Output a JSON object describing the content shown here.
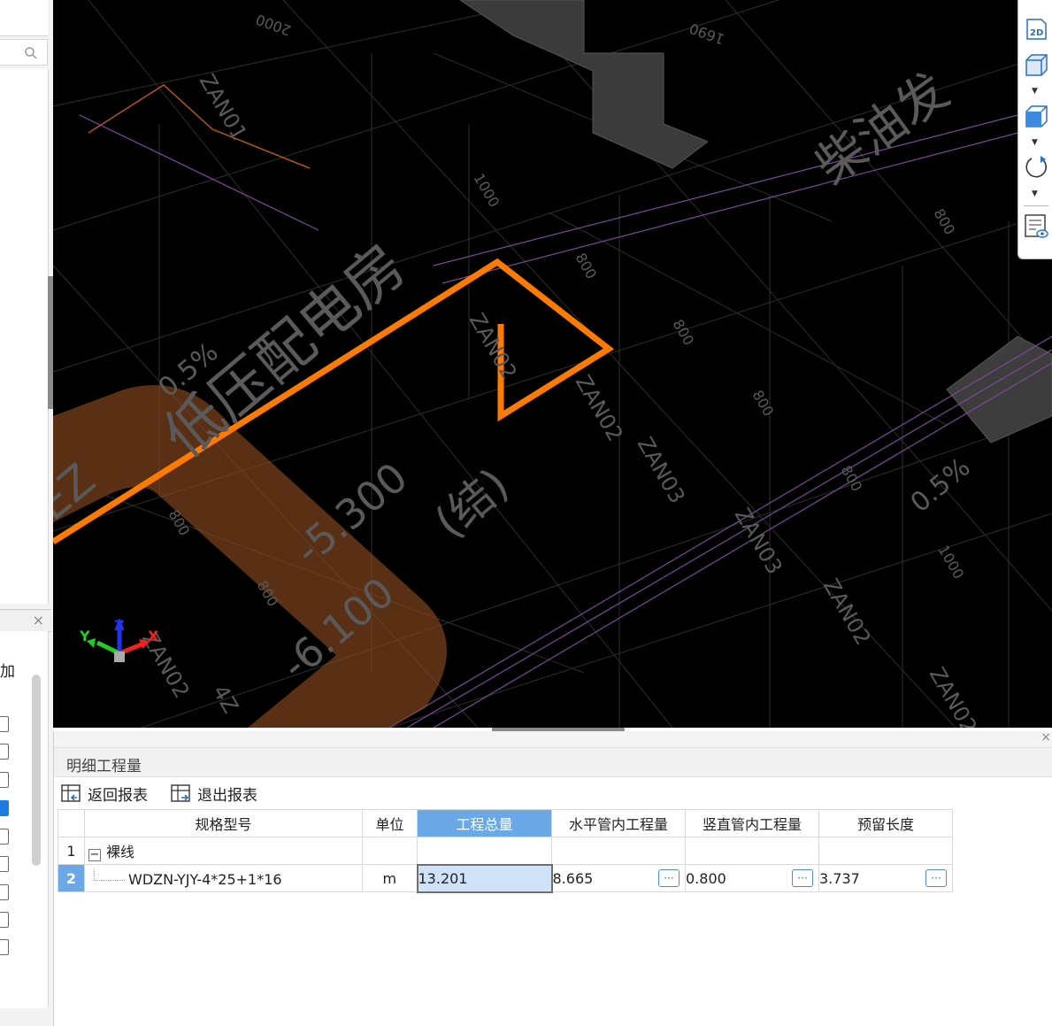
{
  "panel": {
    "title": "明细工程量",
    "close": "×",
    "return_report": "返回报表",
    "exit_report": "退出报表"
  },
  "table": {
    "headers": [
      "规格型号",
      "单位",
      "工程总量",
      "水平管内工程量",
      "竖直管内工程量",
      "预留长度"
    ],
    "active_header_index": 2,
    "rows": [
      {
        "num": "1",
        "toggle": "−",
        "spec": "裸线",
        "unit": "",
        "total": "",
        "horizontal": "",
        "vertical": "",
        "reserved": ""
      },
      {
        "num": "2",
        "toggle": "",
        "spec": "WDZN-YJY-4*25+1*16",
        "unit": "m",
        "total": "13.201",
        "horizontal": "8.665",
        "vertical": "0.800",
        "reserved": "3.737"
      }
    ],
    "ellipsis": "···"
  },
  "left_panel": {
    "close": "×",
    "add_label": "加",
    "checkboxes": [
      false,
      false,
      false,
      true,
      false,
      false,
      false,
      false,
      false
    ]
  },
  "viewport": {
    "labels": {
      "room": "柴油发",
      "room2": "低压配电房",
      "struct": "(结)",
      "level1": "-5.300",
      "level2": "-6.100",
      "slope1": "0.5%",
      "slope2": "0.5%",
      "dim": "800",
      "dim2": "1000",
      "dim3": "2000",
      "dim4": "1690",
      "dim5": "1000",
      "pipe1": "ZAN02",
      "pipe2": "ZAN02",
      "pipe3": "ZAN03",
      "pipe4": "ZAN03",
      "pipe5": "ZAN02",
      "pipe6": "ZAN02",
      "pipe7": "ZAN02",
      "pipe8": "ZAN01",
      "pipe9": "4Z",
      "wall": "EZ",
      "axis_x": "X",
      "axis_y": "Y",
      "axis_z": "Z"
    },
    "colors": {
      "cable": "#ff7a00",
      "grid": "#3a3a3a",
      "purple": "#8a4fa8",
      "text": "#5a5a5a"
    }
  },
  "view_toolbar": {
    "btn_2d": "2D",
    "icons": [
      "2d-view-icon",
      "cube-view-icon",
      "cube-face-icon",
      "rotate-icon",
      "layer-visibility-icon"
    ]
  }
}
